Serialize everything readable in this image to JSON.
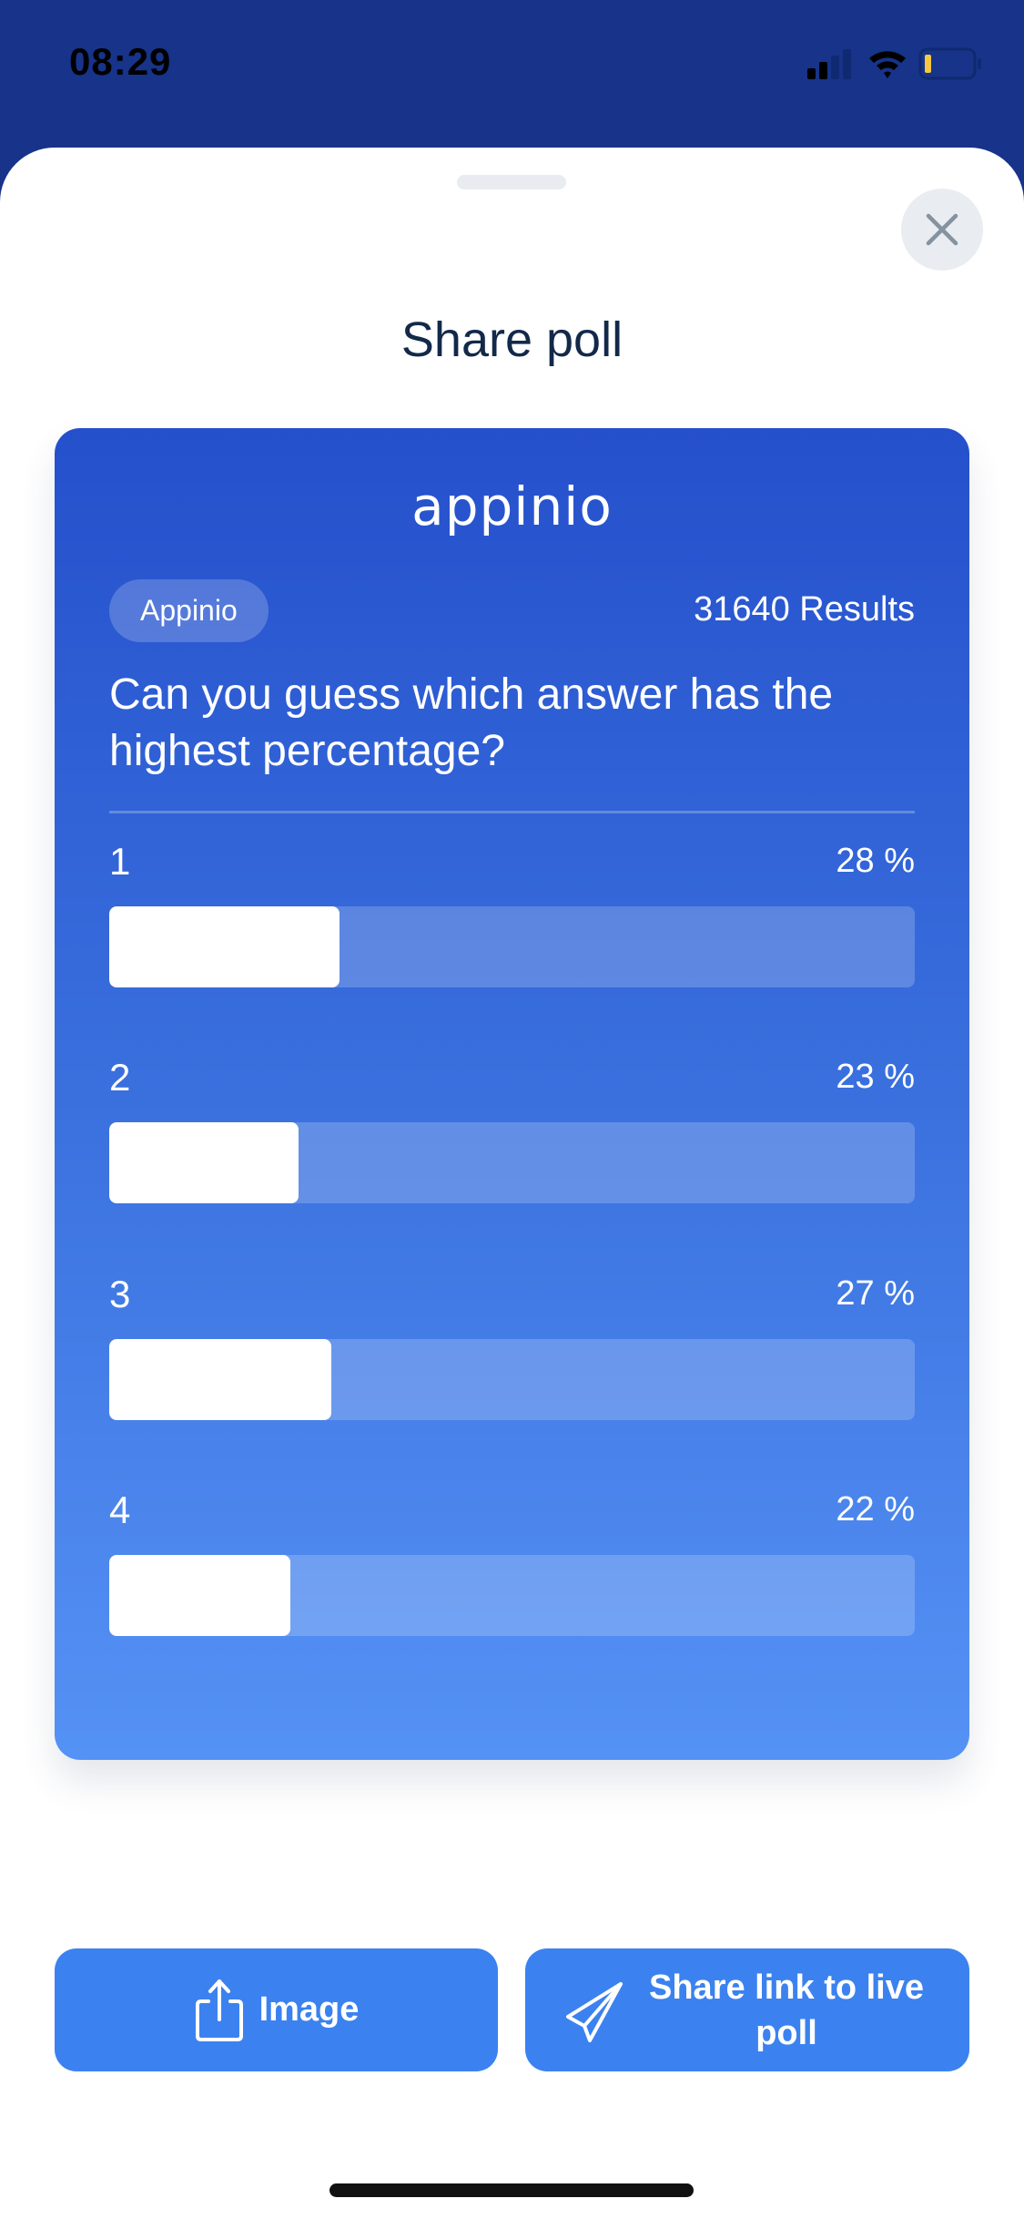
{
  "status_bar": {
    "time": "08:29",
    "icons": [
      "signal-icon",
      "wifi-icon",
      "battery-icon"
    ],
    "battery_color": "#F5C842"
  },
  "sheet": {
    "title": "Share poll",
    "close_icon": "close-icon"
  },
  "card": {
    "logo_text": "appinio",
    "chip_label": "Appinio",
    "results_label": "31640 Results",
    "question": "Can you guess which answer has the highest percentage?",
    "options": [
      {
        "label": "1",
        "percent_label": "28 %",
        "percent": 28
      },
      {
        "label": "2",
        "percent_label": "23 %",
        "percent": 23
      },
      {
        "label": "3",
        "percent_label": "27 %",
        "percent": 27
      },
      {
        "label": "4",
        "percent_label": "22 %",
        "percent": 22
      }
    ],
    "gradient_colors": [
      "#2550CC",
      "#5592F5"
    ]
  },
  "actions": {
    "image_button": {
      "label": "Image",
      "icon": "share-upload-icon"
    },
    "share_link_button": {
      "label": "Share link to live poll",
      "icon": "paper-plane-icon"
    },
    "button_color": "#3B82F0"
  },
  "colors": {
    "header_bg": "#17338A",
    "title_text": "#12294A"
  }
}
